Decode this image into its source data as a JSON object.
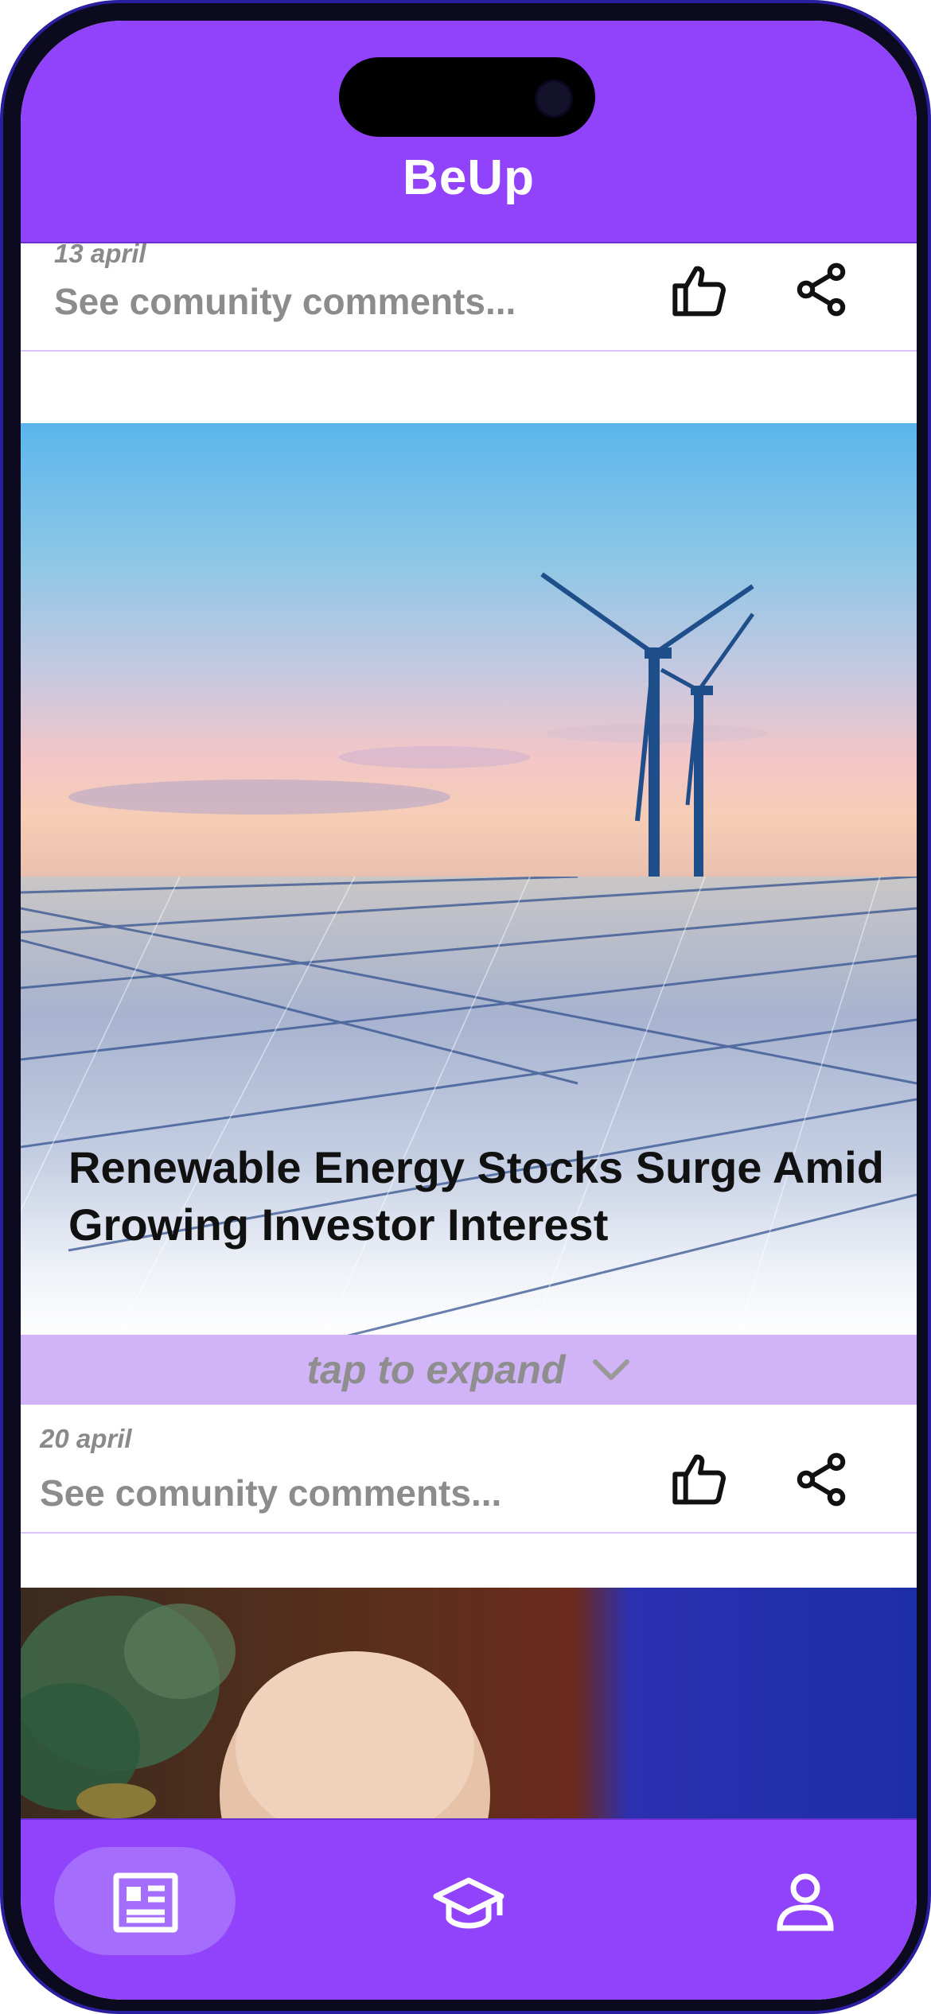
{
  "app": {
    "title": "BeUp"
  },
  "feed": {
    "items": [
      {
        "date": "13 april",
        "comments_label": "See comunity comments...",
        "like_icon": "thumbs-up-icon",
        "share_icon": "share-icon"
      },
      {
        "headline": "Renewable Energy Stocks Surge Amid Growing Investor Interest",
        "image": "wind-turbines-and-solar-panels",
        "expand_label": "tap to expand",
        "expand_icon": "chevron-down-icon",
        "date": "20 april",
        "comments_label": "See comunity comments...",
        "like_icon": "thumbs-up-icon",
        "share_icon": "share-icon"
      },
      {
        "image": "news-photo-person"
      }
    ]
  },
  "bottom_nav": {
    "items": [
      {
        "name": "news",
        "icon": "newspaper-icon",
        "active": true
      },
      {
        "name": "learn",
        "icon": "graduation-cap-icon",
        "active": false
      },
      {
        "name": "profile",
        "icon": "user-icon",
        "active": false
      }
    ]
  },
  "colors": {
    "primary": "#9142fb",
    "expand_bar": "#d1b4f7",
    "active_pill": "#a46dfb",
    "muted_text": "#8c8c8c"
  }
}
